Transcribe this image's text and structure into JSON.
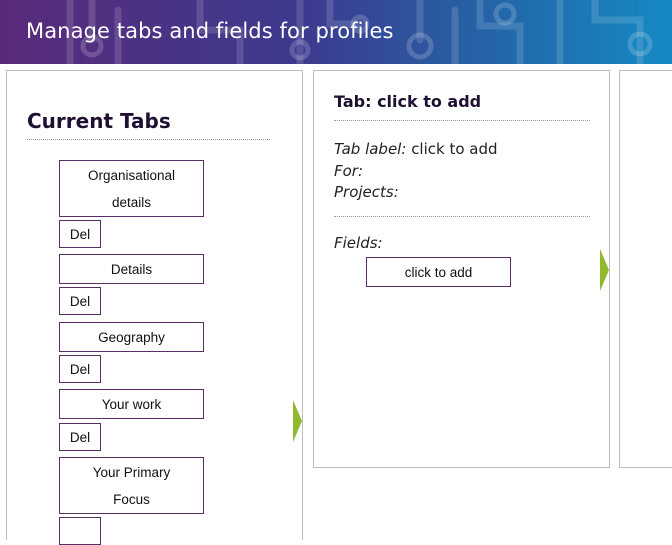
{
  "header": {
    "title": "Manage tabs and fields for profiles"
  },
  "current_tabs": {
    "title": "Current Tabs",
    "del_label": "Del",
    "tabs": [
      {
        "label": "Organisational details"
      },
      {
        "label": "Details"
      },
      {
        "label": "Geography"
      },
      {
        "label": "Your work"
      },
      {
        "label": "Your Primary Focus"
      }
    ]
  },
  "tab_editor": {
    "heading": "Tab: click to add",
    "tab_label_caption": "Tab label:",
    "tab_label_value": "click to add",
    "for_caption": "For:",
    "projects_caption": "Projects:",
    "fields_caption": "Fields:",
    "add_field_label": "click to add"
  },
  "colors": {
    "arrow": "#8fba2e",
    "border": "#5a2d68",
    "heading": "#1e1030"
  }
}
